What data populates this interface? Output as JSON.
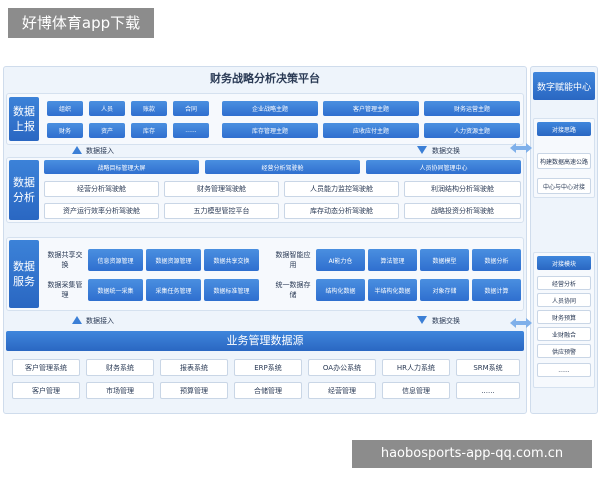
{
  "header_tag": "好博体育app下载",
  "footer_tag": "haobosports-app-qq.com.cn",
  "main_title": "财务战略分析决策平台",
  "side_title": "数字赋能中心",
  "layers": {
    "report": {
      "label": "数据上报",
      "left_items": [
        "组织",
        "人员",
        "账款",
        "合同",
        "财务",
        "资产",
        "库存",
        "......"
      ],
      "right_items": [
        "企业战略主题",
        "客户管理主题",
        "财务运营主题",
        "库存管理主题",
        "应收应付主题",
        "人力资源主题"
      ]
    },
    "analysis": {
      "label": "数据分析",
      "top_items": [
        "战略目标管理大屏",
        "经营分析驾驶舱",
        "人员协同管理中心"
      ],
      "grid_items": [
        "经营分析驾驶舱",
        "财务管理驾驶舱",
        "人员能力监控驾驶舱",
        "利润结构分析驾驶舱",
        "资产运行效率分析驾驶舱",
        "五力模型管控平台",
        "库存动态分析驾驶舱",
        "战略投资分析驾驶舱"
      ]
    },
    "service": {
      "label": "数据服务",
      "left_labels": [
        "数据共享交换",
        "数据采集管理"
      ],
      "left_items": [
        "信息资源管理",
        "数据资源管理",
        "数据共享交换",
        "数据统一采集",
        "采集任务管理",
        "数据标准管理"
      ],
      "right_labels": [
        "数据智能应用",
        "统一数据存储"
      ],
      "right_items": [
        "AI能力仓",
        "算法管理",
        "数据模型",
        "数据分析",
        "结构化数据",
        "半结构化数据",
        "对象存储",
        "数据计算"
      ]
    }
  },
  "arrows": {
    "access_label": "数据接入",
    "exchange_label": "数据交换"
  },
  "source": {
    "title": "业务管理数据源",
    "systems": [
      "客户管理系统",
      "财务系统",
      "报表系统",
      "ERP系统",
      "OA办公系统",
      "HR人力系统",
      "SRM系统"
    ],
    "modules": [
      "客户管理",
      "市场管理",
      "预算管理",
      "合储管理",
      "经营管理",
      "信息管理",
      "......"
    ]
  },
  "side": {
    "panel1_head": "对接思路",
    "panel1_items": [
      "构建数据高速公路",
      "中心与中心对接"
    ],
    "panel2_head": "对接模块",
    "panel2_items": [
      "经营分析",
      "人员协同",
      "财务预算",
      "业财融合",
      "供应预警",
      "......"
    ]
  },
  "colors": {
    "accent": "#2f6fcf",
    "panel_bg": "#eef4fb",
    "tag_gray": "#8c8c8c"
  }
}
